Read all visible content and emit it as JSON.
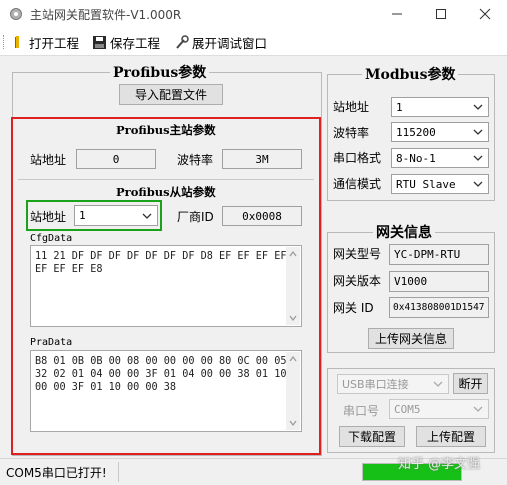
{
  "window": {
    "title": "主站网关配置软件-V1.000R"
  },
  "toolbar": {
    "open": "打开工程",
    "save": "保存工程",
    "debug": "展开调试窗口"
  },
  "profibus": {
    "title": "Profibus参数",
    "import_button": "导入配置文件",
    "master": {
      "title": "Profibus主站参数",
      "station_label": "站地址",
      "station_value": "0",
      "baud_label": "波特率",
      "baud_value": "3M"
    },
    "slave": {
      "title": "Profibus从站参数",
      "station_label": "站地址",
      "station_value": "1",
      "vendor_label": "厂商ID",
      "vendor_value": "0x0008",
      "cfg_label": "CfgData",
      "cfg_lines": [
        "11 21 DF DF DF DF DF DF DF D8 EF EF EF EF",
        "EF EF EF E8"
      ],
      "prm_label": "PraData",
      "prm_lines": [
        "B8 01 0B 0B 00 08 00 00 00 00 80 0C 00 05",
        "32 02 01 04 00 00 3F 01 04 00 00 38 01 10",
        "00 00 3F 01 10 00 00 38"
      ]
    }
  },
  "modbus": {
    "title": "Modbus参数",
    "station_label": "站地址",
    "station_value": "1",
    "baud_label": "波特率",
    "baud_value": "115200",
    "format_label": "串口格式",
    "format_value": "8-No-1",
    "mode_label": "通信模式",
    "mode_value": "RTU Slave"
  },
  "gateway": {
    "title": "网关信息",
    "model_label": "网关型号",
    "model_value": "YC-DPM-RTU",
    "version_label": "网关版本",
    "version_value": "V1000",
    "id_label": "网关 ID",
    "id_value": "0x413808001D1547",
    "upload_button": "上传网关信息"
  },
  "connection": {
    "conn_type": "USB串口连接",
    "disconnect_button": "断开",
    "port_label": "串口号",
    "port_value": "COM5",
    "download_button": "下载配置",
    "upload_button": "上传配置"
  },
  "status": {
    "text": "COM5串口已打开!",
    "watermark": "知乎 @李文强"
  },
  "colors": {
    "highlight_red": "#e02020",
    "highlight_green": "#1aa31a",
    "progress_green": "#16c016"
  },
  "icons": {
    "app": "gear-icon",
    "open": "folder-icon",
    "save": "floppy-icon",
    "debug": "tools-icon"
  }
}
